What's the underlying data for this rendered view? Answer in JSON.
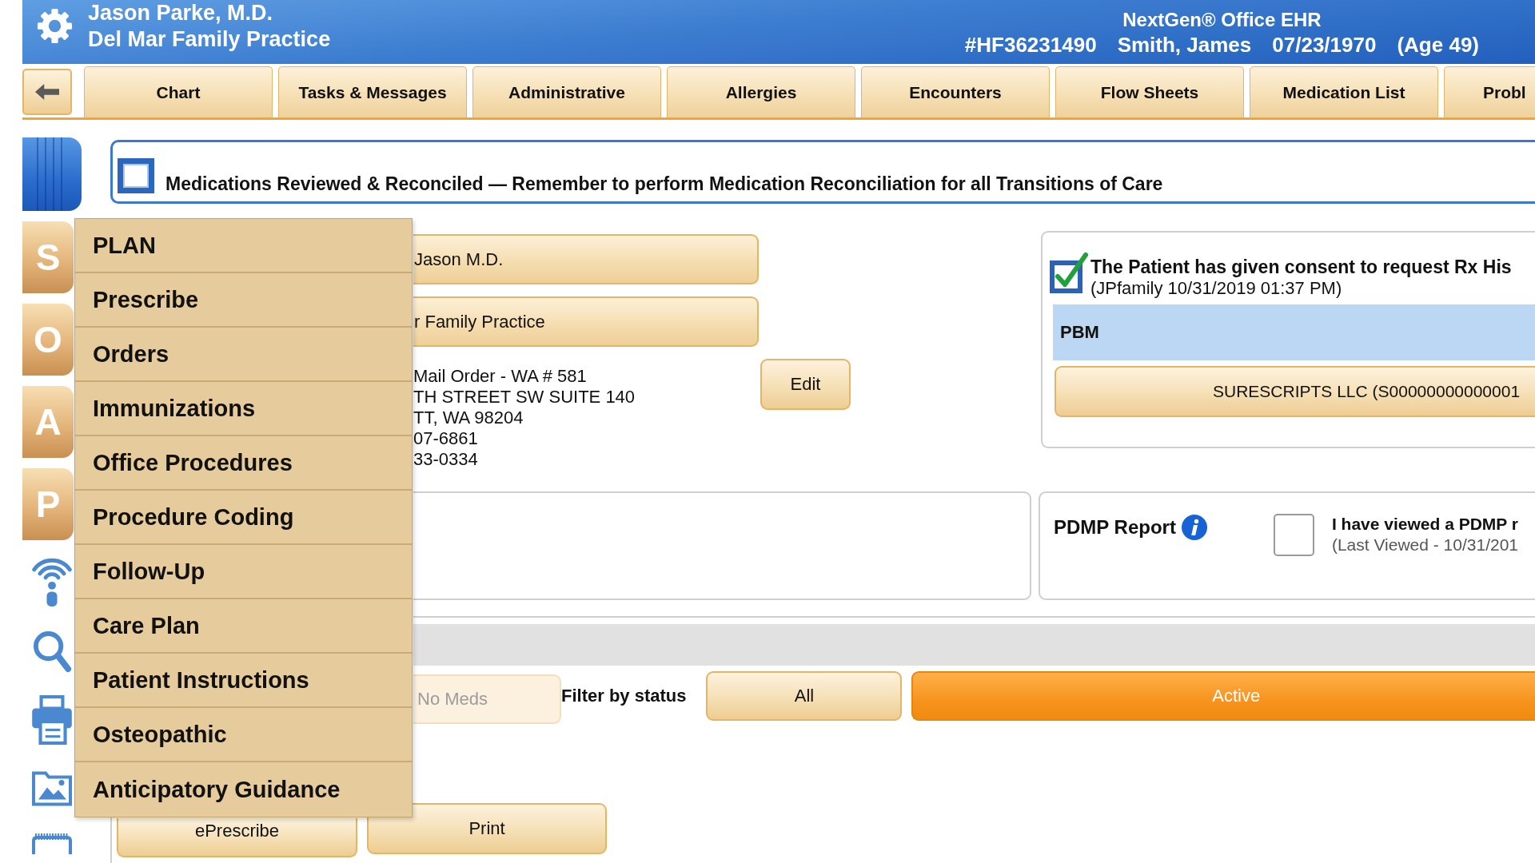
{
  "header": {
    "user_name": "Jason Parke, M.D.",
    "practice": "Del Mar Family Practice",
    "product": "NextGen® Office EHR",
    "patient": {
      "chart_number": "#HF36231490",
      "name": "Smith, James",
      "birth_date": "07/23/1970",
      "age": "(Age 49)"
    }
  },
  "tabs": [
    {
      "label": "Chart",
      "selected": false
    },
    {
      "label": "Tasks & Messages",
      "selected": false
    },
    {
      "label": "Administrative",
      "selected": false
    },
    {
      "label": "Allergies",
      "selected": false
    },
    {
      "label": "Encounters",
      "selected": false
    },
    {
      "label": "Flow Sheets",
      "selected": false
    },
    {
      "label": "Medication List",
      "selected": false
    },
    {
      "label": "Probl",
      "selected": false
    }
  ],
  "sidebar": {
    "soap_tabs": [
      {
        "label": "S"
      },
      {
        "label": "O"
      },
      {
        "label": "A"
      },
      {
        "label": "P"
      }
    ]
  },
  "plan_menu": {
    "items": [
      {
        "label": "PLAN"
      },
      {
        "label": "Prescribe"
      },
      {
        "label": "Orders"
      },
      {
        "label": "Immunizations"
      },
      {
        "label": "Office Procedures"
      },
      {
        "label": "Procedure Coding"
      },
      {
        "label": "Follow-Up"
      },
      {
        "label": "Care Plan"
      },
      {
        "label": "Patient Instructions"
      },
      {
        "label": "Osteopathic"
      },
      {
        "label": "Anticipatory Guidance"
      }
    ]
  },
  "reconcile_banner": {
    "checked": false,
    "text": "Medications Reviewed & Reconciled — Remember to perform Medication Reconciliation for all Transitions of Care"
  },
  "pharmacy": {
    "provider": "Jason M.D.",
    "practice": "r Family Practice",
    "address_lines": [
      "Mail Order - WA # 581",
      "TH STREET SW SUITE 140",
      "TT, WA 98204",
      "07-6861",
      "33-0334"
    ],
    "edit_button": "Edit"
  },
  "consent": {
    "checked": true,
    "text": "The Patient has given consent to request Rx His",
    "timestamp": "(JPfamily 10/31/2019 01:37 PM)",
    "pbm_label": "PBM",
    "pbm_button": "SURESCRIPTS LLC (S00000000000001"
  },
  "pdmp": {
    "title": "PDMP Report",
    "checked": false,
    "statement": "I have viewed a PDMP r",
    "last_viewed": "(Last Viewed - 10/31/201"
  },
  "med_filter": {
    "no_meds": {
      "label": "No Meds",
      "disabled": true
    },
    "label": "Filter by status",
    "options": [
      {
        "label": "All",
        "selected": false
      },
      {
        "label": "Active",
        "selected": true
      }
    ]
  },
  "footer_buttons": [
    {
      "label": "ePrescribe"
    },
    {
      "label": "Print"
    }
  ]
}
